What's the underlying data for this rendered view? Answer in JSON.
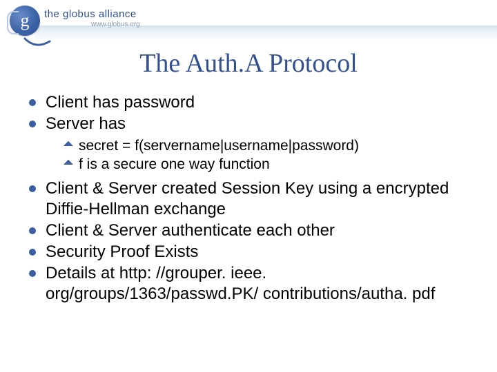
{
  "logo": {
    "letter": "g",
    "brand": "the globus alliance",
    "url": "www.globus.org"
  },
  "title": "The Auth.A Protocol",
  "bullets": [
    {
      "text": "Client has password"
    },
    {
      "text": "Server has",
      "children": [
        "secret = f(servername|username|password)",
        "f is a secure one way function"
      ]
    },
    {
      "text": "Client & Server created Session Key using a encrypted Diffie-Hellman exchange"
    },
    {
      "text": "Client & Server authenticate each other"
    },
    {
      "text": "Security Proof Exists"
    },
    {
      "text": "Details at http: //grouper. ieee. org/groups/1363/passwd.PK/ contributions/autha. pdf"
    }
  ]
}
